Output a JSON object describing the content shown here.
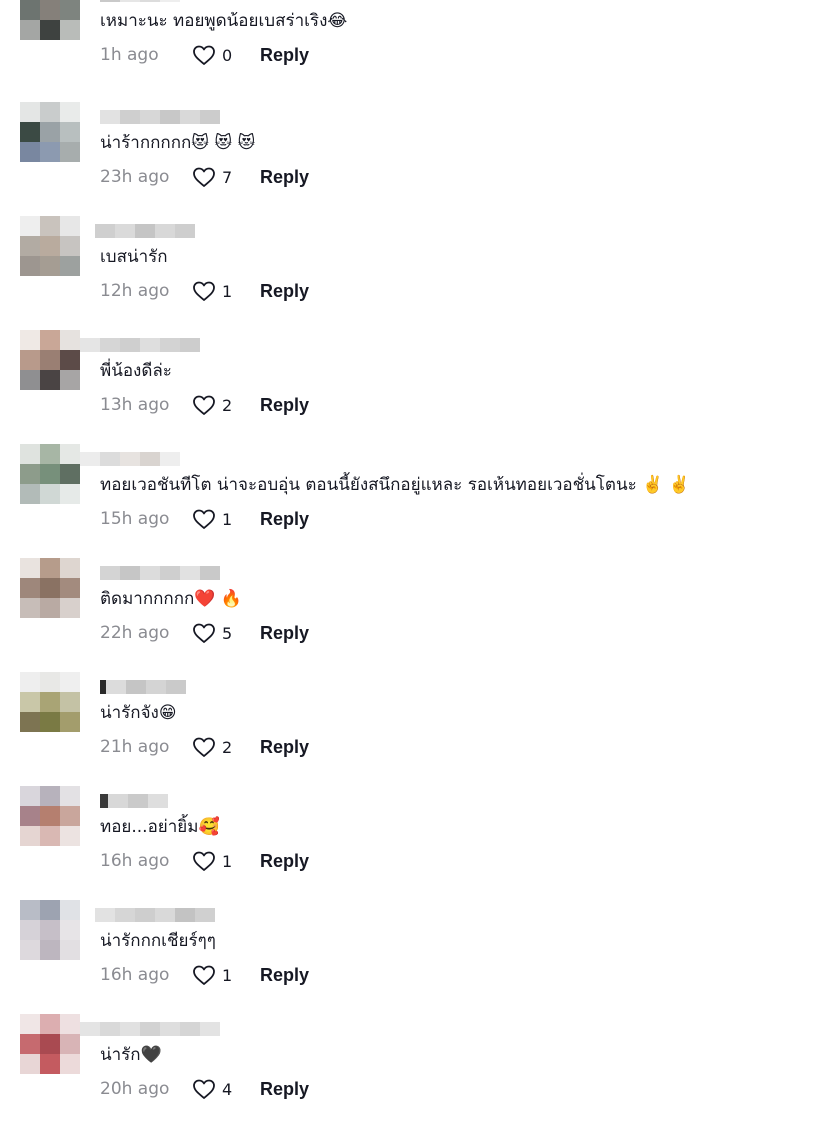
{
  "comments": [
    {
      "text": "เหมาะนะ ทอยพูดน้อยเบสร่าเริง😂",
      "time": "1h ago",
      "likes": "0",
      "reply": "Reply"
    },
    {
      "text": "น่าร้ากกกกก😻 😻 😻",
      "time": "23h ago",
      "likes": "7",
      "reply": "Reply"
    },
    {
      "text": "เบสน่ารัก",
      "time": "12h ago",
      "likes": "1",
      "reply": "Reply"
    },
    {
      "text": "พี่น้องดีล่ะ",
      "time": "13h ago",
      "likes": "2",
      "reply": "Reply"
    },
    {
      "text": "ทอยเวอชันทีโต น่าจะอบอุ่น ตอนนี้ยังสนึกอยู่แหละ รอเห้นทอยเวอชั่นโตนะ ✌️ ✌️",
      "time": "15h ago",
      "likes": "1",
      "reply": "Reply"
    },
    {
      "text": "ติดมากกกกก❤️ 🔥",
      "time": "22h ago",
      "likes": "5",
      "reply": "Reply"
    },
    {
      "text": "น่ารักจัง😁",
      "time": "21h ago",
      "likes": "2",
      "reply": "Reply"
    },
    {
      "text": "ทอย...อย่ายิ้ม🥰",
      "time": "16h ago",
      "likes": "1",
      "reply": "Reply"
    },
    {
      "text": "น่ารักกกเชียร์ๆๆ",
      "time": "16h ago",
      "likes": "1",
      "reply": "Reply"
    },
    {
      "text": "น่ารัก🖤",
      "time": "20h ago",
      "likes": "4",
      "reply": "Reply"
    }
  ],
  "colors": {
    "time": "#8a8b91",
    "text": "#161823",
    "background": "#ffffff"
  },
  "icons": {
    "like": "heart-outline-icon"
  }
}
